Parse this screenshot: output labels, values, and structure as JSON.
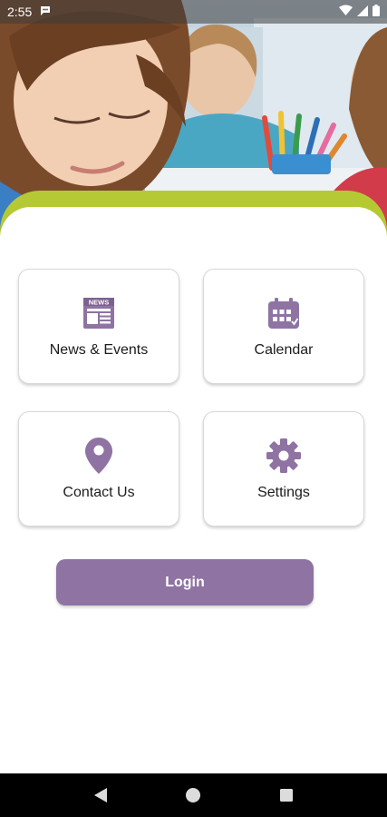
{
  "status_bar": {
    "time": "2:55"
  },
  "tiles": [
    {
      "label": "News & Events",
      "icon": "news-icon"
    },
    {
      "label": "Calendar",
      "icon": "calendar-icon"
    },
    {
      "label": "Contact Us",
      "icon": "location-pin-icon"
    },
    {
      "label": "Settings",
      "icon": "gear-icon"
    }
  ],
  "login": {
    "label": "Login"
  },
  "colors": {
    "accent_purple": "#8f73a3",
    "band_green": "#b5c935"
  }
}
